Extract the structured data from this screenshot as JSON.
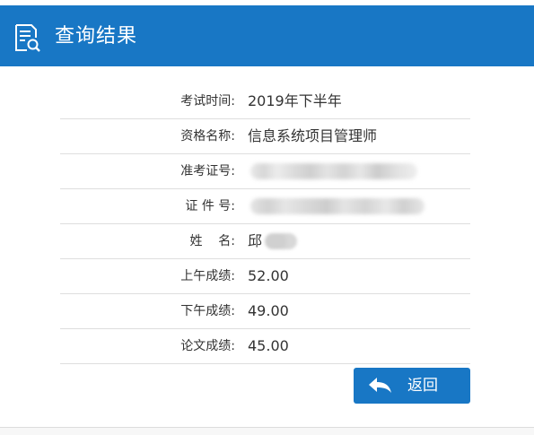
{
  "header": {
    "title": "查询结果",
    "icon": "search-document-icon",
    "background": "#1877c5"
  },
  "results": [
    {
      "label": "考试时间:",
      "value": "2019年下半年"
    },
    {
      "label": "资格名称:",
      "value": "信息系统项目管理师"
    },
    {
      "label": "准考证号:",
      "value": ""
    },
    {
      "label": "证 件 号:",
      "value": ""
    },
    {
      "label": "姓    名:",
      "value": "邱"
    },
    {
      "label": "上午成绩:",
      "value": "52.00"
    },
    {
      "label": "下午成绩:",
      "value": "49.00"
    },
    {
      "label": "论文成绩:",
      "value": "45.00"
    }
  ],
  "actions": {
    "back_label": "返回",
    "back_icon": "reply-arrow-icon"
  }
}
